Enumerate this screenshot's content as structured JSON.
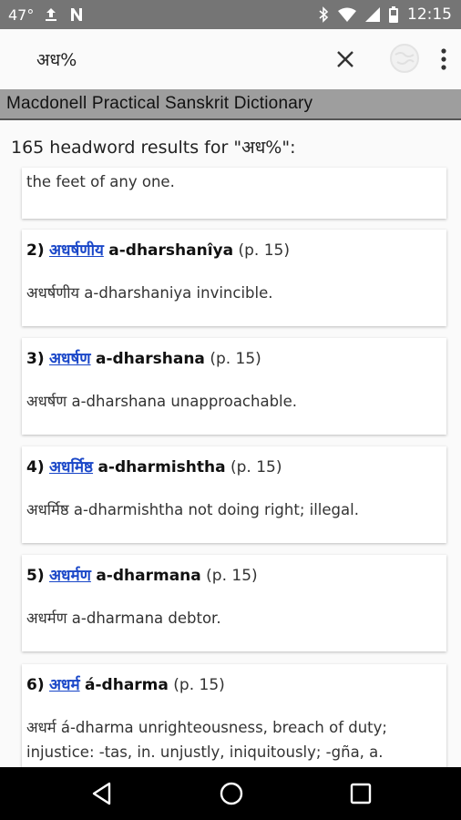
{
  "status": {
    "temp": "47°",
    "time": "12:15"
  },
  "search": {
    "query": "अध%"
  },
  "dictionary": {
    "title": "Macdonell Practical Sanskrit Dictionary"
  },
  "results": {
    "summary": "165 headword results for \"अध%\":",
    "partial_text": "the feet of any one.",
    "entries": [
      {
        "num": "2)",
        "dev": "अधर्षणीय",
        "translit": "a-dharshanîya",
        "page": "(p. 15)",
        "def": "अधर्षणीय a-dharshaniya invincible."
      },
      {
        "num": "3)",
        "dev": "अधर्षण",
        "translit": "a-dharshana",
        "page": "(p. 15)",
        "def": "अधर्षण a-dharshana unapproachable."
      },
      {
        "num": "4)",
        "dev": "अधर्मिष्ठ",
        "translit": "a-dharmishtha",
        "page": "(p. 15)",
        "def": "अधर्मिष्ठ a-dharmishtha not doing right; illegal."
      },
      {
        "num": "5)",
        "dev": "अधर्मण",
        "translit": "a-dharmana",
        "page": "(p. 15)",
        "def": "अधर्मण a-dharmana debtor."
      },
      {
        "num": "6)",
        "dev": "अधर्म",
        "translit": "á-dharma",
        "page": "(p. 15)",
        "def": "अधर्म á-dharma unrighteousness, breach of duty; injustice: -tas, in. unjustly, iniquitously; -gña, a."
      }
    ]
  },
  "icons": {
    "status_left": [
      "upload-icon",
      "notification-n-icon"
    ],
    "status_right": [
      "bluetooth-icon",
      "wifi-icon",
      "signal-icon",
      "battery-icon"
    ],
    "toolbar": [
      "close-icon",
      "globe-icon",
      "overflow-menu-icon"
    ],
    "nav": [
      "back-icon",
      "home-icon",
      "recents-icon"
    ]
  },
  "colors": {
    "link": "#1a47c8",
    "header_bg": "#9e9e9e",
    "status_bg": "#757575"
  }
}
